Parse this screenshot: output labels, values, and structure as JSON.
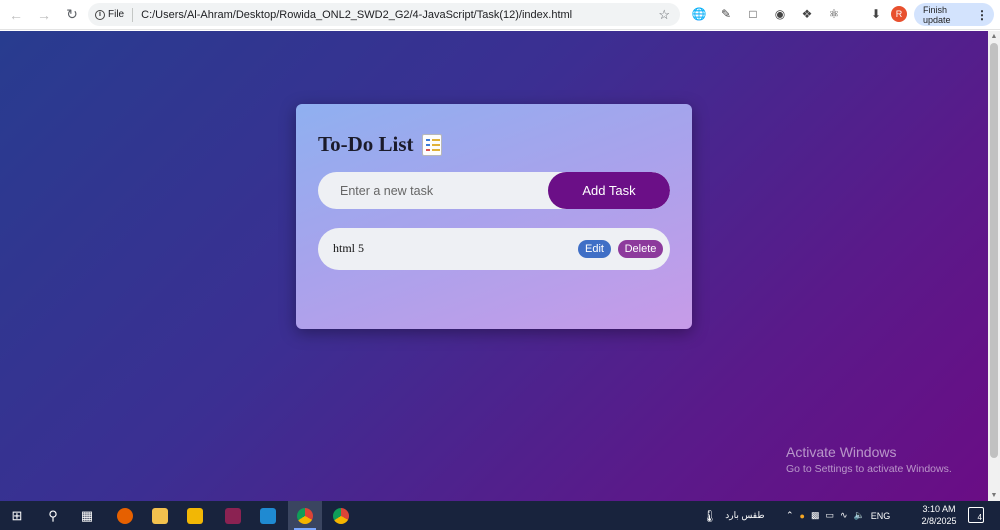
{
  "browser": {
    "file_label": "File",
    "url": "C:/Users/Al-Ahram/Desktop/Rowida_ONL2_SWD2_G2/4-JavaScript/Task(12)/index.html",
    "avatar_letter": "R",
    "finish_update_label": "Finish update"
  },
  "app": {
    "title": "To-Do List",
    "input_placeholder": "Enter a new task",
    "add_button_label": "Add Task",
    "tasks": [
      {
        "text": "html 5",
        "edit_label": "Edit",
        "delete_label": "Delete"
      }
    ]
  },
  "watermark": {
    "line1": "Activate Windows",
    "line2": "Go to Settings to activate Windows."
  },
  "taskbar": {
    "weather_text": "طقس بارد",
    "language": "ENG",
    "time": "3:10 AM",
    "date": "2/8/2025",
    "notification_count": "4"
  },
  "colors": {
    "add_button": "#6b0f87",
    "edit_button": "#3f6fc6",
    "delete_button": "#8d3a9c",
    "avatar": "#e8502e"
  }
}
